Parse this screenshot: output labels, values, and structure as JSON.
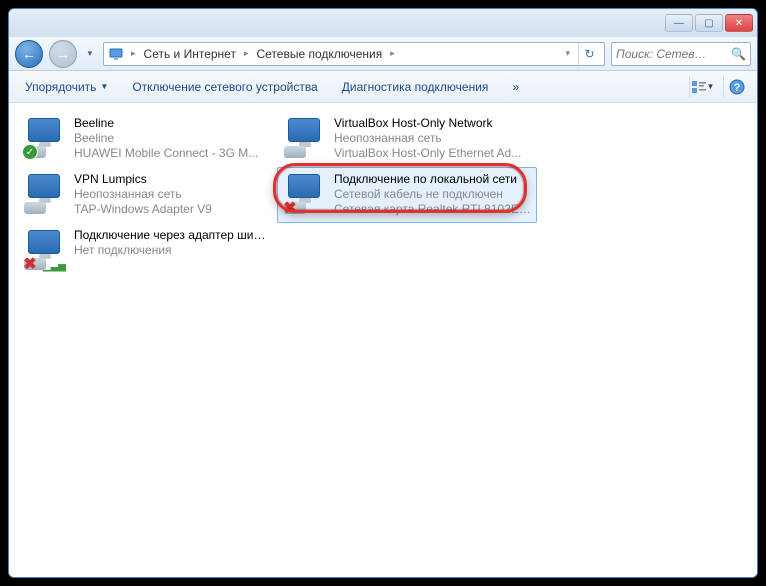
{
  "titlebar": {
    "min": "—",
    "max": "▢",
    "close": "✕"
  },
  "breadcrumb": {
    "items": [
      "Сеть и Интернет",
      "Сетевые подключения"
    ]
  },
  "search": {
    "placeholder": "Поиск: Сетев…"
  },
  "toolbar": {
    "organize": "Упорядочить",
    "disable": "Отключение сетевого устройства",
    "diagnose": "Диагностика подключения",
    "more": "»"
  },
  "connections": [
    {
      "name": "Beeline",
      "status": "Beeline",
      "device": "HUAWEI Mobile Connect - 3G M...",
      "badge": "ok"
    },
    {
      "name": "VirtualBox Host-Only Network",
      "status": "Неопознанная сеть",
      "device": "VirtualBox Host-Only Ethernet Ad...",
      "badge": "none"
    },
    {
      "name": "VPN Lumpics",
      "status": "Неопознанная сеть",
      "device": "TAP-Windows Adapter V9",
      "badge": "none"
    },
    {
      "name": "Подключение по локальной сети",
      "status": "Сетевой кабель не подключен",
      "device": "Сетевая карта Realtek RTL8102E/...",
      "badge": "x",
      "selected": true
    },
    {
      "name": "Подключение через адаптер широкополосной мобильной с...",
      "status": "Нет подключения",
      "device": "",
      "badge": "x-bars"
    }
  ]
}
